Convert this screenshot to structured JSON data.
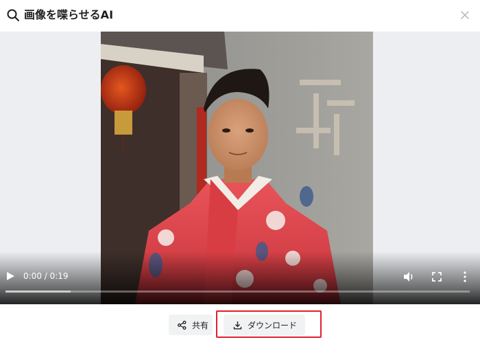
{
  "header": {
    "title": "画像を喋らせるAI",
    "search_icon": "search-icon",
    "close_icon": "close-icon"
  },
  "video": {
    "current_time": "0:00",
    "duration": "0:19",
    "time_display": "0:00 / 0:19",
    "progress_played_fraction": 0.0,
    "progress_buffered_fraction": 0.14,
    "controls": [
      "play-icon",
      "volume-icon",
      "fullscreen-icon",
      "more-vertical-icon"
    ]
  },
  "actions": {
    "share_label": "共有",
    "download_label": "ダウンロード",
    "share_icon": "share-icon",
    "download_icon": "download-icon"
  },
  "colors": {
    "highlight_border": "#e0202a",
    "button_bg": "#f1f2f4",
    "video_side_bg": "#eceef1"
  }
}
